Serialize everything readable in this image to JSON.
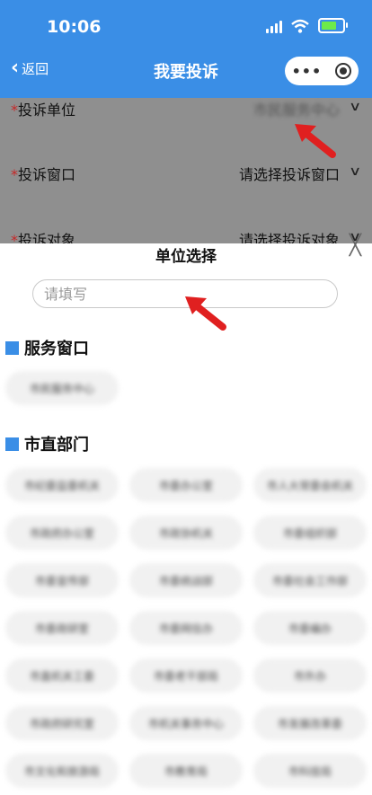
{
  "status_bar": {
    "time": "10:06"
  },
  "nav": {
    "back_label": "返回",
    "title": "我要投诉"
  },
  "form": [
    {
      "label": "投诉单位",
      "value": "市民服务中心",
      "blurred": true
    },
    {
      "label": "投诉窗口",
      "value": "请选择投诉窗口",
      "blurred": false
    },
    {
      "label": "投诉对象",
      "value": "请选择投诉对象",
      "blurred": false
    }
  ],
  "sheet": {
    "title": "单位选择",
    "search_placeholder": "请填写",
    "sections": [
      {
        "title": "服务窗口",
        "items": [
          "市民服务中心"
        ]
      },
      {
        "title": "市直部门",
        "items": [
          "市纪委监委机关",
          "市委办公室",
          "市人大常委会机关",
          "市政府办公室",
          "市政协机关",
          "市委组织部",
          "市委宣传部",
          "市委统战部",
          "市委社会工作部",
          "市委政研室",
          "市委网信办",
          "市委编办",
          "市直机关工委",
          "市委老干部局",
          "市外办",
          "市政府研究室",
          "市机关事务中心",
          "市发展改革委",
          "市文化和旅游局",
          "市教育局",
          "市科技局"
        ]
      }
    ]
  },
  "colors": {
    "header": "#3a8ee6",
    "accent_square": "#3a8ee6",
    "annotation_arrow": "#e02020",
    "required_star": "#c62828"
  }
}
